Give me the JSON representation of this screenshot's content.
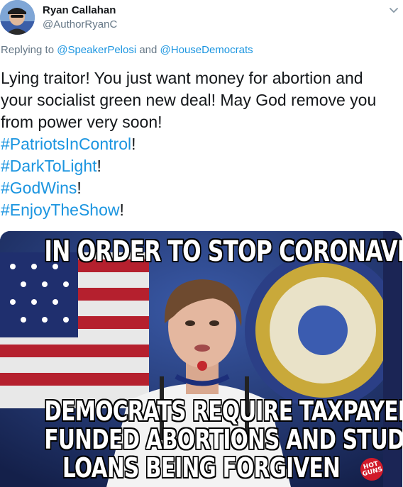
{
  "tweet": {
    "author_name": "Ryan Callahan",
    "author_handle": "@AuthorRyanC",
    "reply_prefix": "Replying to",
    "reply_mention_1": "@SpeakerPelosi",
    "reply_and": "and",
    "reply_mention_2": "@HouseDemocrats",
    "body_line_1": "Lying traitor!  You just want money for abortion and",
    "body_line_2": "your socialist green new deal!  May God remove you",
    "body_line_3": "from power very soon!",
    "hashtags": [
      {
        "tag": "#PatriotsInControl",
        "suffix": "!"
      },
      {
        "tag": "#DarkToLight",
        "suffix": "!"
      },
      {
        "tag": "#GodWins",
        "suffix": "!"
      },
      {
        "tag": "#EnjoyTheShow",
        "suffix": "!"
      }
    ]
  },
  "media": {
    "top_caption": "IN ORDER TO STOP CORONAVIRUS",
    "bottom_caption_1": "DEMOCRATS REQUIRE TAXPAYER",
    "bottom_caption_2": "FUNDED  ABORTIONS AND STUDENT",
    "bottom_caption_3": "LOANS BEING FORGIVEN",
    "logo_text": "HOT GUNS"
  },
  "icons": {
    "menu": "chevron-down-icon"
  },
  "colors": {
    "link": "#1b95e0",
    "muted": "#657786",
    "text": "#14171a"
  }
}
